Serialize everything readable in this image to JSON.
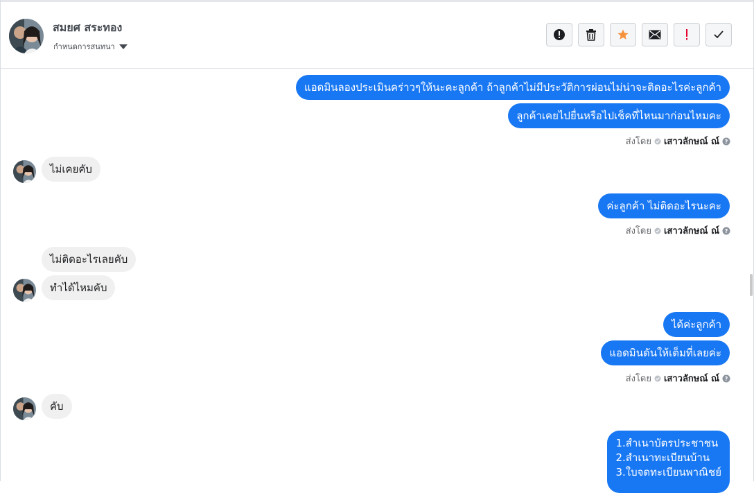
{
  "header": {
    "contact_name": "สมยศ สระทอง",
    "assign_label": "กำหนดการสนทนา",
    "actions": [
      {
        "name": "report-button",
        "icon": "alert-circle-icon"
      },
      {
        "name": "delete-button",
        "icon": "trash-icon"
      },
      {
        "name": "star-button",
        "icon": "star-icon"
      },
      {
        "name": "mark-unread-button",
        "icon": "envelope-icon"
      },
      {
        "name": "follow-up-button",
        "icon": "exclamation-icon"
      },
      {
        "name": "mark-done-button",
        "icon": "check-icon"
      }
    ]
  },
  "sent_by": {
    "label": "ส่งโดย",
    "agent": "เสาวลักษณ์ ณ์"
  },
  "messages": {
    "m1": "แอดมินลองประเมินคร่าวๆให้นะคะลูกค้า ถ้าลูกค้าไม่มีประวัติการผ่อนไม่น่าจะติดอะไรค่ะลูกค้า",
    "m2": "ลูกค้าเคยไปยื่นหรือไปเช็คที่ไหนมาก่อนไหมคะ",
    "m3": "ไม่เคยคับ",
    "m4": "ค่ะลูกค้า ไม่ติดอะไรนะคะ",
    "m5": "ไม่ติดอะไรเลยคับ",
    "m6": "ทำได้ไหมคับ",
    "m7": "ได้ค่ะลูกค้า",
    "m8": "แอดมินดันให้เต็มที่เลยค่ะ",
    "m9": "คับ",
    "m10_lines": [
      "1.สำเนาบัตรประชาชน",
      "2.สำเนาทะเบียนบ้าน",
      "3.ใบจดทะเบียนพาณิชย์"
    ]
  },
  "colors": {
    "outgoing": "#1877f2",
    "incoming": "#f0f0f0",
    "star": "#f7923b",
    "exclamation": "#e4002b"
  }
}
